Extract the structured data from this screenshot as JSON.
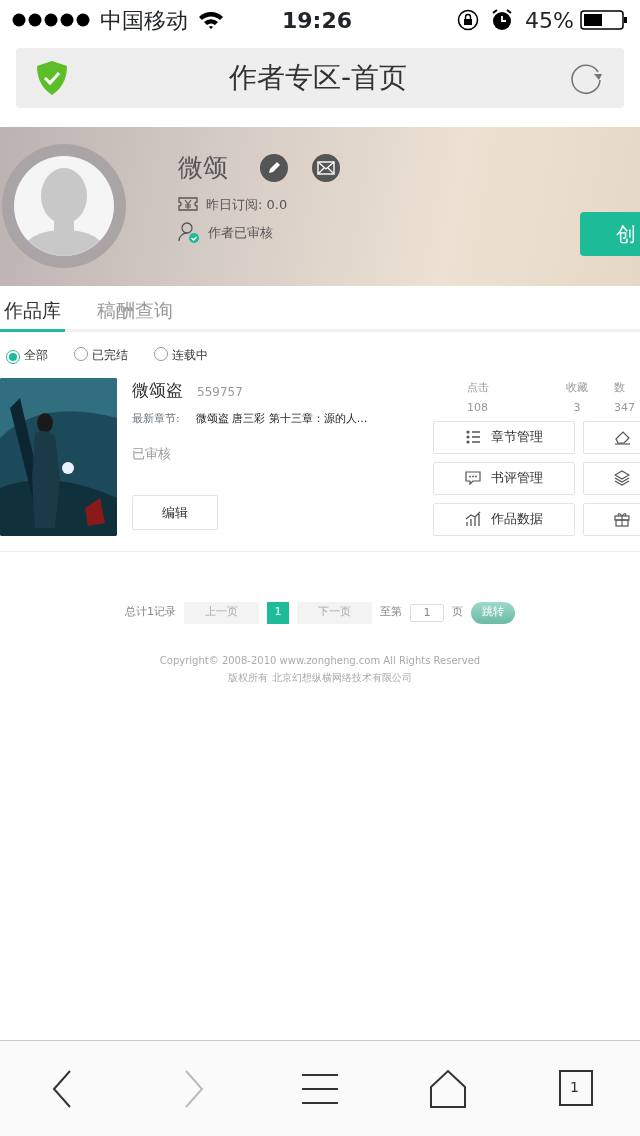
{
  "status_bar": {
    "carrier": "中国移动",
    "time": "19:26",
    "battery": "45%"
  },
  "address_bar": {
    "title": "作者专区-首页"
  },
  "profile": {
    "name": "微颂",
    "subscription": "昨日订阅: 0.0",
    "verification": "作者已审核",
    "create_button": "创"
  },
  "tabs": [
    {
      "label": "作品库",
      "selected": true
    },
    {
      "label": "稿酬查询",
      "selected": false
    }
  ],
  "filters": [
    {
      "label": "全部",
      "selected": true
    },
    {
      "label": "已完结",
      "selected": false
    },
    {
      "label": "连载中",
      "selected": false
    }
  ],
  "books": [
    {
      "title": "微颂盗",
      "number": "559757",
      "latest_label": "最新章节:",
      "latest_chapter": "微颂盗 唐三彩 第十三章：源的人...",
      "status": "已审核",
      "edit_button": "编辑",
      "stats": [
        {
          "label": "点击",
          "value": "108"
        },
        {
          "label": "收藏",
          "value": "3"
        },
        {
          "label": "数",
          "value": "347"
        }
      ],
      "actions": [
        {
          "kind": "list",
          "label": "章节管理"
        },
        {
          "kind": "eraser"
        },
        {
          "kind": "comment",
          "label": "书评管理"
        },
        {
          "kind": "layers"
        },
        {
          "kind": "chart",
          "label": "作品数据"
        },
        {
          "kind": "gift"
        }
      ]
    }
  ],
  "pagination": {
    "total": "总计1记录",
    "prev": "上一页",
    "pages": [
      {
        "label": "1",
        "selected": true
      }
    ],
    "next": "下一页",
    "goto_prefix": "至第",
    "goto_value": "1",
    "goto_suffix": "页",
    "goto_button": "跳转"
  },
  "footer": {
    "copyright_prefix": "Copyright©",
    "years": "2008-2010",
    "copyright_suffix": "www.zongheng.com All Rights Reserved",
    "company": "版权所有 北京幻想纵横网络技术有限公司"
  },
  "toolbar": [
    {
      "kind": "back",
      "disabled": false
    },
    {
      "kind": "forward",
      "disabled": true
    },
    {
      "kind": "menu",
      "disabled": false
    },
    {
      "kind": "home",
      "disabled": false
    },
    {
      "kind": "tabs",
      "disabled": false,
      "label": "1"
    }
  ]
}
